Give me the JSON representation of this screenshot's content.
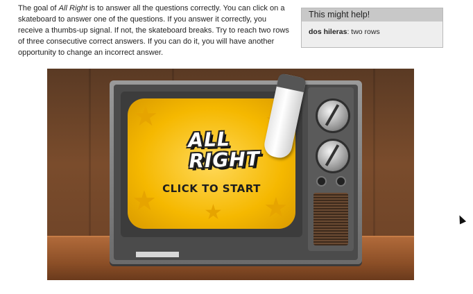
{
  "intro": {
    "text_before": "The goal of ",
    "game_name": "All Right",
    "text_after": " is to answer all the questions correctly. You can click on a skateboard to answer one of the questions. If you answer it correctly, you receive a thumbs-up signal. If not, the skateboard breaks. Try to reach two rows of three consecutive correct answers. If you can do it, you will have another opportunity to change an incorrect answer."
  },
  "help": {
    "title": "This might help!",
    "term": "dos hileras",
    "definition": ": two rows"
  },
  "game": {
    "logo_line1": "ALL",
    "logo_line2": "RIGHT",
    "start_label": "CLICK TO START"
  },
  "colors": {
    "screen_yellow": "#f5b800",
    "help_header": "#c8c8c8",
    "help_bg": "#eeeeee"
  }
}
